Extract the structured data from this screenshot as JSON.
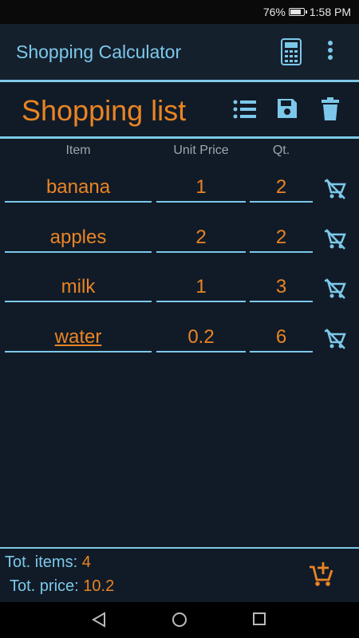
{
  "status": {
    "battery": "76%",
    "time": "1:58 PM"
  },
  "appbar": {
    "title": "Shopping Calculator",
    "icons": [
      "calculator-icon",
      "more-vert-icon"
    ]
  },
  "list": {
    "title": "Shopping list",
    "icons": [
      "list-icon",
      "save-icon",
      "delete-icon"
    ],
    "columns": [
      "Item",
      "Unit Price",
      "Qt."
    ],
    "rows": [
      {
        "item": "banana",
        "price": "1",
        "qty": "2"
      },
      {
        "item": "apples",
        "price": "2",
        "qty": "2"
      },
      {
        "item": "milk",
        "price": "1",
        "qty": "3"
      },
      {
        "item": "water",
        "price": "0.2",
        "qty": "6"
      }
    ]
  },
  "totals": {
    "items_label": "Tot. items:",
    "items_value": "4",
    "price_label": "Tot. price:",
    "price_value": "10.2"
  },
  "colors": {
    "accent_orange": "#ea8424",
    "accent_blue": "#7cc8ea",
    "background": "#111b27"
  }
}
